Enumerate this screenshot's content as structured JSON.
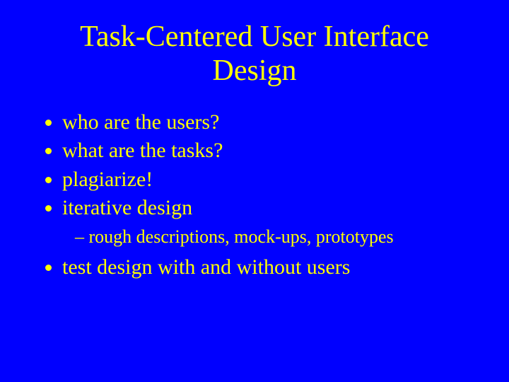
{
  "title": "Task-Centered User Interface Design",
  "bullets": {
    "b1": "who are the users?",
    "b2": "what are the tasks?",
    "b3": "plagiarize!",
    "b4": "iterative design",
    "b4_sub1": "rough descriptions, mock-ups, prototypes",
    "b5": "test design with and without users"
  }
}
